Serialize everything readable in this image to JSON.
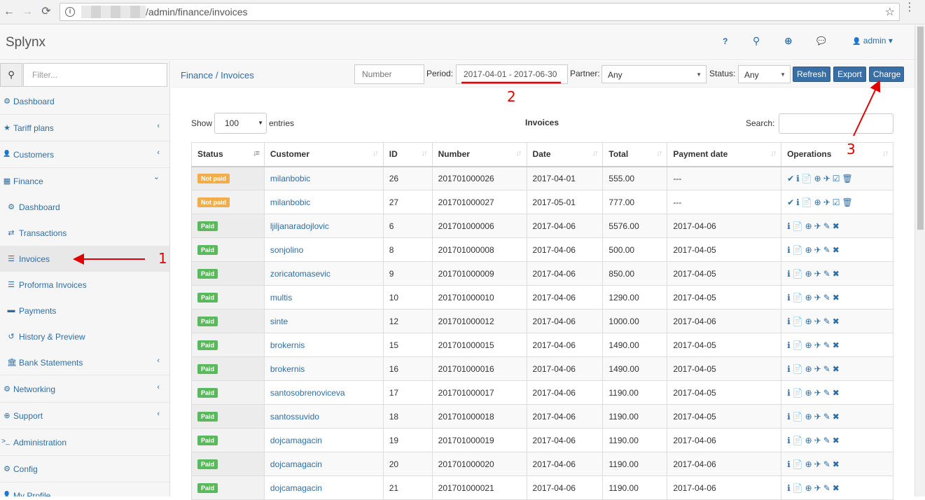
{
  "browser": {
    "url_path": "/admin/finance/invoices",
    "back_icon": "←",
    "forward_icon": "→",
    "reload_icon": "⟳",
    "info_icon": "i",
    "star_icon": "☆",
    "menu_icon": "⋮"
  },
  "header": {
    "brand": "Splynx",
    "help_icon": "?",
    "search_icon": "⚲",
    "globe_icon": "⊕",
    "chat_icon": "💬",
    "user_icon": "👤",
    "user": "admin ▾"
  },
  "sidebar": {
    "search_icon": "⚲",
    "filter_placeholder": "Filter...",
    "items": [
      {
        "label": "Dashboard",
        "icon": "⚙"
      },
      {
        "label": "Tariff plans",
        "icon": "★",
        "chevron": "‹"
      },
      {
        "label": "Customers",
        "icon": "👤",
        "chevron": "‹"
      },
      {
        "label": "Finance",
        "icon": "▦",
        "chevron": "⌄"
      }
    ],
    "finance_sub": [
      {
        "label": "Dashboard",
        "icon": "⚙"
      },
      {
        "label": "Transactions",
        "icon": "⇄"
      },
      {
        "label": "Invoices",
        "icon": "☰"
      },
      {
        "label": "Proforma Invoices",
        "icon": "☰"
      },
      {
        "label": "Payments",
        "icon": "▬"
      },
      {
        "label": "History & Preview",
        "icon": "↺"
      },
      {
        "label": "Bank Statements",
        "icon": "🏛",
        "chevron": "‹"
      }
    ],
    "items2": [
      {
        "label": "Networking",
        "icon": "⚙",
        "chevron": "‹"
      },
      {
        "label": "Support",
        "icon": "⊕",
        "chevron": "‹"
      },
      {
        "label": "Administration",
        "icon": ">_"
      },
      {
        "label": "Config",
        "icon": "⚙"
      },
      {
        "label": "My Profile",
        "icon": "👤"
      }
    ]
  },
  "toolbar": {
    "breadcrumb": "Finance / Invoices",
    "number_placeholder": "Number",
    "period_label": "Period:",
    "period_value": "2017-04-01 - 2017-06-30",
    "partner_label": "Partner:",
    "partner_value": "Any",
    "status_label": "Status:",
    "status_value": "Any",
    "caret": "▼",
    "refresh": "Refresh",
    "export": "Export",
    "charge": "Charge"
  },
  "datatable": {
    "show_label": "Show",
    "length_value": "100",
    "entries_label": "entries",
    "title": "Invoices",
    "search_label": "Search:",
    "sort_icon": "↓↑",
    "sort_active_icon": "↓≡",
    "columns": [
      "Status",
      "Customer",
      "ID",
      "Number",
      "Date",
      "Total",
      "Payment date",
      "Operations"
    ],
    "rows": [
      {
        "status": "Not paid",
        "customer": "milanbobic",
        "id": "26",
        "number": "201701000026",
        "date": "2017-04-01",
        "total": "555.00",
        "payment_date": "---",
        "ops": [
          "✔",
          "ℹ",
          "📄",
          "⊕",
          "✈",
          "☑",
          "🗑"
        ]
      },
      {
        "status": "Not paid",
        "customer": "milanbobic",
        "id": "27",
        "number": "201701000027",
        "date": "2017-05-01",
        "total": "777.00",
        "payment_date": "---",
        "ops": [
          "✔",
          "ℹ",
          "📄",
          "⊕",
          "✈",
          "☑",
          "🗑"
        ]
      },
      {
        "status": "Paid",
        "customer": "ljiljanaradojlovic",
        "id": "6",
        "number": "201701000006",
        "date": "2017-04-06",
        "total": "5576.00",
        "payment_date": "2017-04-06",
        "ops": [
          "ℹ",
          "📄",
          "⊕",
          "✈",
          "✎",
          "✖"
        ]
      },
      {
        "status": "Paid",
        "customer": "sonjolino",
        "id": "8",
        "number": "201701000008",
        "date": "2017-04-06",
        "total": "500.00",
        "payment_date": "2017-04-05",
        "ops": [
          "ℹ",
          "📄",
          "⊕",
          "✈",
          "✎",
          "✖"
        ]
      },
      {
        "status": "Paid",
        "customer": "zoricatomasevic",
        "id": "9",
        "number": "201701000009",
        "date": "2017-04-06",
        "total": "850.00",
        "payment_date": "2017-04-05",
        "ops": [
          "ℹ",
          "📄",
          "⊕",
          "✈",
          "✎",
          "✖"
        ]
      },
      {
        "status": "Paid",
        "customer": "multis",
        "id": "10",
        "number": "201701000010",
        "date": "2017-04-06",
        "total": "1290.00",
        "payment_date": "2017-04-05",
        "ops": [
          "ℹ",
          "📄",
          "⊕",
          "✈",
          "✎",
          "✖"
        ]
      },
      {
        "status": "Paid",
        "customer": "sinte",
        "id": "12",
        "number": "201701000012",
        "date": "2017-04-06",
        "total": "1000.00",
        "payment_date": "2017-04-06",
        "ops": [
          "ℹ",
          "📄",
          "⊕",
          "✈",
          "✎",
          "✖"
        ]
      },
      {
        "status": "Paid",
        "customer": "brokernis",
        "id": "15",
        "number": "201701000015",
        "date": "2017-04-06",
        "total": "1490.00",
        "payment_date": "2017-04-05",
        "ops": [
          "ℹ",
          "📄",
          "⊕",
          "✈",
          "✎",
          "✖"
        ]
      },
      {
        "status": "Paid",
        "customer": "brokernis",
        "id": "16",
        "number": "201701000016",
        "date": "2017-04-06",
        "total": "1490.00",
        "payment_date": "2017-04-05",
        "ops": [
          "ℹ",
          "📄",
          "⊕",
          "✈",
          "✎",
          "✖"
        ]
      },
      {
        "status": "Paid",
        "customer": "santosobrenoviceva",
        "id": "17",
        "number": "201701000017",
        "date": "2017-04-06",
        "total": "1190.00",
        "payment_date": "2017-04-05",
        "ops": [
          "ℹ",
          "📄",
          "⊕",
          "✈",
          "✎",
          "✖"
        ]
      },
      {
        "status": "Paid",
        "customer": "santossuvido",
        "id": "18",
        "number": "201701000018",
        "date": "2017-04-06",
        "total": "1190.00",
        "payment_date": "2017-04-05",
        "ops": [
          "ℹ",
          "📄",
          "⊕",
          "✈",
          "✎",
          "✖"
        ]
      },
      {
        "status": "Paid",
        "customer": "dojcamagacin",
        "id": "19",
        "number": "201701000019",
        "date": "2017-04-06",
        "total": "1190.00",
        "payment_date": "2017-04-06",
        "ops": [
          "ℹ",
          "📄",
          "⊕",
          "✈",
          "✎",
          "✖"
        ]
      },
      {
        "status": "Paid",
        "customer": "dojcamagacin",
        "id": "20",
        "number": "201701000020",
        "date": "2017-04-06",
        "total": "1190.00",
        "payment_date": "2017-04-06",
        "ops": [
          "ℹ",
          "📄",
          "⊕",
          "✈",
          "✎",
          "✖"
        ]
      },
      {
        "status": "Paid",
        "customer": "dojcamagacin",
        "id": "21",
        "number": "201701000021",
        "date": "2017-04-06",
        "total": "1190.00",
        "payment_date": "2017-04-06",
        "ops": [
          "ℹ",
          "📄",
          "⊕",
          "✈",
          "✎",
          "✖"
        ]
      }
    ]
  },
  "annotations": {
    "one": "1",
    "two": "2",
    "three": "3",
    "color": "#e00000"
  },
  "colors": {
    "link": "#2e6da4",
    "button": "#3a6fa5",
    "not_paid": "#f0ad4e",
    "paid": "#5cb85c"
  }
}
